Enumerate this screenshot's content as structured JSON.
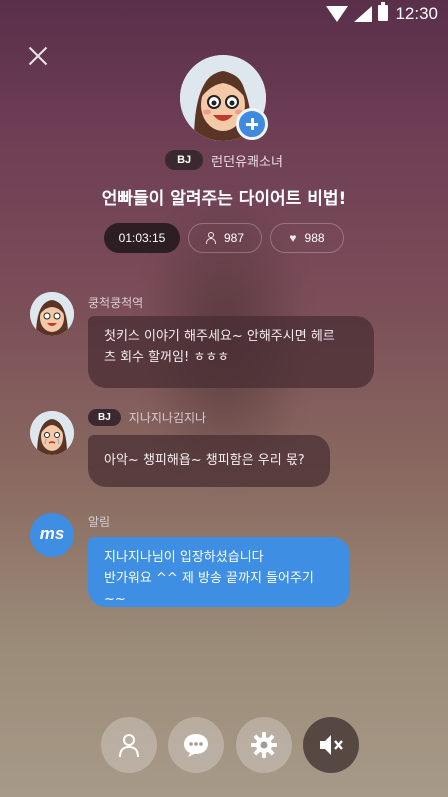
{
  "status": {
    "time": "12:30"
  },
  "header": {
    "bj_badge": "BJ",
    "bj_name": "런던유쾌소녀",
    "title": "언빠들이 알려주는 다이어트 비법!",
    "stats": {
      "elapsed": "01:03:15",
      "viewers": "987",
      "likes": "988"
    }
  },
  "messages": [
    {
      "name": "쿵척쿵척역",
      "badge": "",
      "text": "첫키스 이야기 해주세요~ 안해주시면  헤르\n츠 회수 할꺼임! ㅎㅎㅎ"
    },
    {
      "name": "지나지나김지나",
      "badge": "BJ",
      "text": "아악~ 챙피해욥~ 챙피함은 우리 몫?"
    },
    {
      "name": "알림",
      "badge": "",
      "avatar_text": "ms",
      "text": "지나지나님이 입장하셨습니다\n반가워요 ^^ 제 방송 끝까지 들어주기~~"
    }
  ],
  "toolbar": [
    "person-icon",
    "chat-icon",
    "gear-icon",
    "mute-icon"
  ],
  "colors": {
    "accent": "#3e8ee4",
    "badge_bg": "#3a2a30"
  }
}
